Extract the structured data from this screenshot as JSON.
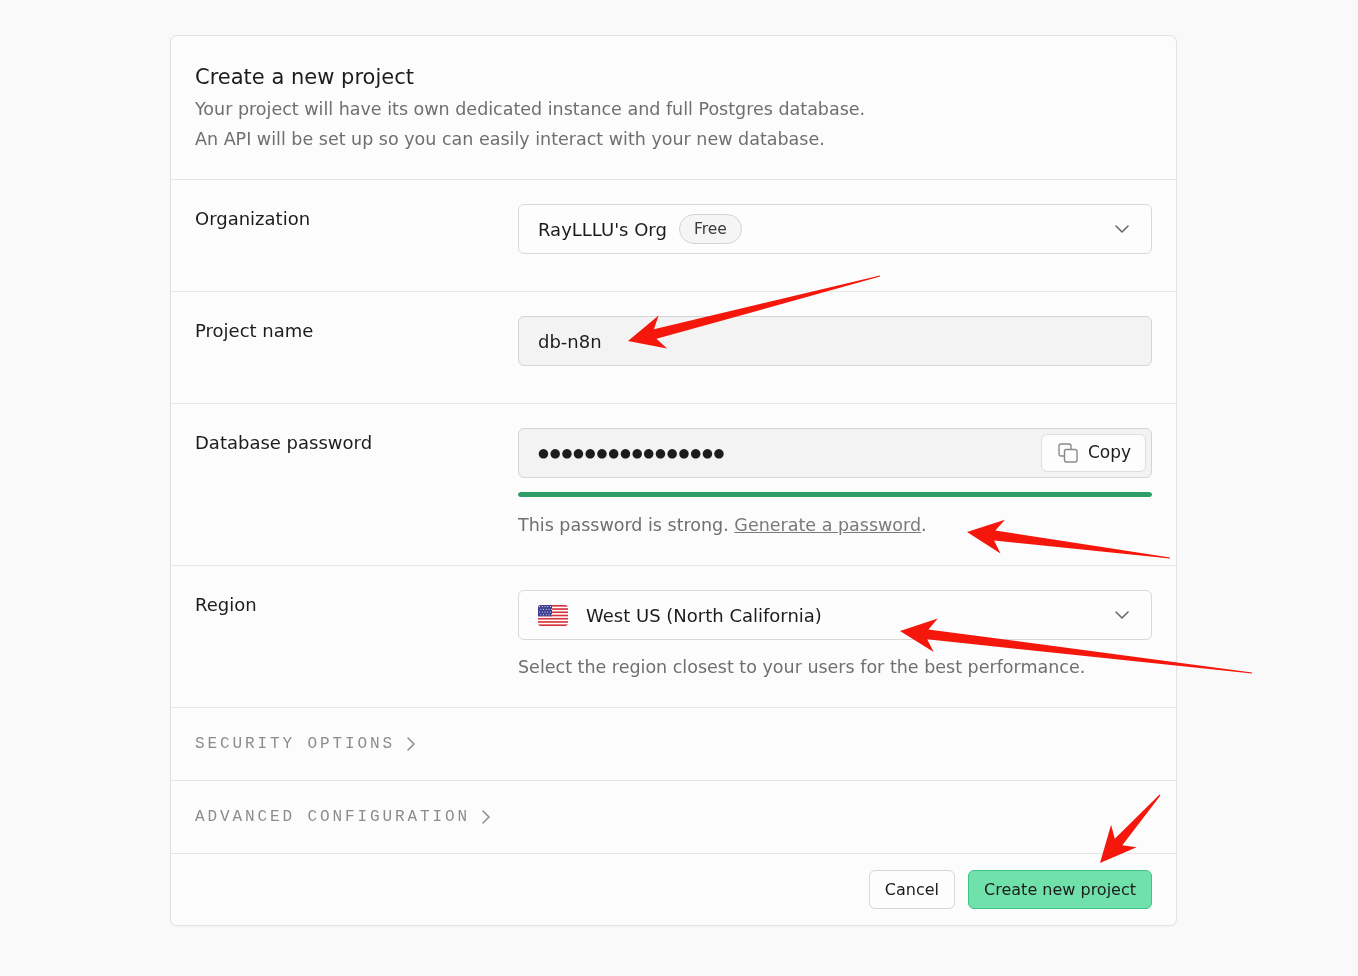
{
  "title": "Create a new project",
  "description": [
    "Your project will have its own dedicated instance and full Postgres database.",
    "An API will be set up so you can easily interact with your new database."
  ],
  "fields": [
    {
      "kind": "select",
      "label": "Organization",
      "value": "RayLLLU's Org",
      "badge": "Free"
    },
    {
      "kind": "text",
      "label": "Project name",
      "value": "db-n8n"
    },
    {
      "kind": "password",
      "label": "Database password",
      "value": "●●●●●●●●●●●●●●●●",
      "copy_button": "Copy",
      "strength": {
        "level": 1
      },
      "help": "This password is strong.",
      "help_link": "Generate a password",
      "help_after": "."
    },
    {
      "kind": "region",
      "label": "Region",
      "value": "West US (North California)",
      "help": "Select the region closest to your users for the best performance."
    }
  ],
  "sections": [
    {
      "label": "SECURITY OPTIONS",
      "expanded": false
    },
    {
      "label": "ADVANCED CONFIGURATION",
      "expanded": false
    }
  ],
  "buttons": [
    {
      "label": "Cancel",
      "kind": "secondary"
    },
    {
      "label": "Create new project",
      "kind": "primary"
    }
  ]
}
